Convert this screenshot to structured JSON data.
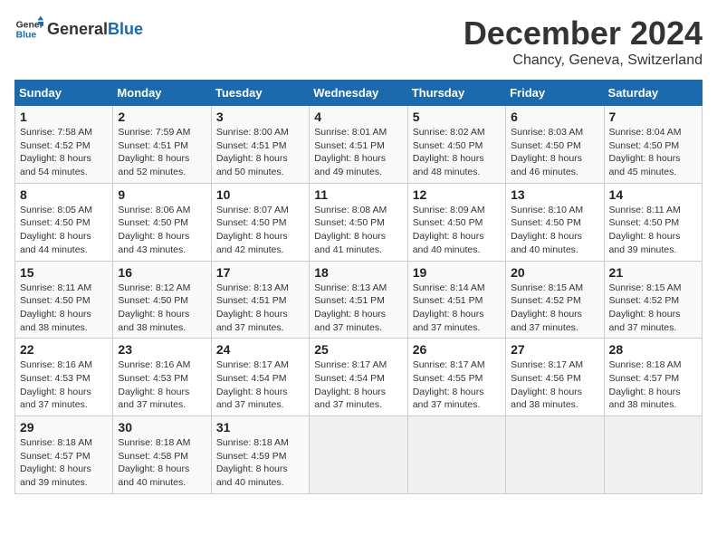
{
  "header": {
    "logo_general": "General",
    "logo_blue": "Blue",
    "month": "December 2024",
    "location": "Chancy, Geneva, Switzerland"
  },
  "weekdays": [
    "Sunday",
    "Monday",
    "Tuesday",
    "Wednesday",
    "Thursday",
    "Friday",
    "Saturday"
  ],
  "weeks": [
    [
      {
        "day": "1",
        "sunrise": "7:58 AM",
        "sunset": "4:52 PM",
        "daylight": "8 hours and 54 minutes."
      },
      {
        "day": "2",
        "sunrise": "7:59 AM",
        "sunset": "4:51 PM",
        "daylight": "8 hours and 52 minutes."
      },
      {
        "day": "3",
        "sunrise": "8:00 AM",
        "sunset": "4:51 PM",
        "daylight": "8 hours and 50 minutes."
      },
      {
        "day": "4",
        "sunrise": "8:01 AM",
        "sunset": "4:51 PM",
        "daylight": "8 hours and 49 minutes."
      },
      {
        "day": "5",
        "sunrise": "8:02 AM",
        "sunset": "4:50 PM",
        "daylight": "8 hours and 48 minutes."
      },
      {
        "day": "6",
        "sunrise": "8:03 AM",
        "sunset": "4:50 PM",
        "daylight": "8 hours and 46 minutes."
      },
      {
        "day": "7",
        "sunrise": "8:04 AM",
        "sunset": "4:50 PM",
        "daylight": "8 hours and 45 minutes."
      }
    ],
    [
      {
        "day": "8",
        "sunrise": "8:05 AM",
        "sunset": "4:50 PM",
        "daylight": "8 hours and 44 minutes."
      },
      {
        "day": "9",
        "sunrise": "8:06 AM",
        "sunset": "4:50 PM",
        "daylight": "8 hours and 43 minutes."
      },
      {
        "day": "10",
        "sunrise": "8:07 AM",
        "sunset": "4:50 PM",
        "daylight": "8 hours and 42 minutes."
      },
      {
        "day": "11",
        "sunrise": "8:08 AM",
        "sunset": "4:50 PM",
        "daylight": "8 hours and 41 minutes."
      },
      {
        "day": "12",
        "sunrise": "8:09 AM",
        "sunset": "4:50 PM",
        "daylight": "8 hours and 40 minutes."
      },
      {
        "day": "13",
        "sunrise": "8:10 AM",
        "sunset": "4:50 PM",
        "daylight": "8 hours and 40 minutes."
      },
      {
        "day": "14",
        "sunrise": "8:11 AM",
        "sunset": "4:50 PM",
        "daylight": "8 hours and 39 minutes."
      }
    ],
    [
      {
        "day": "15",
        "sunrise": "8:11 AM",
        "sunset": "4:50 PM",
        "daylight": "8 hours and 38 minutes."
      },
      {
        "day": "16",
        "sunrise": "8:12 AM",
        "sunset": "4:50 PM",
        "daylight": "8 hours and 38 minutes."
      },
      {
        "day": "17",
        "sunrise": "8:13 AM",
        "sunset": "4:51 PM",
        "daylight": "8 hours and 37 minutes."
      },
      {
        "day": "18",
        "sunrise": "8:13 AM",
        "sunset": "4:51 PM",
        "daylight": "8 hours and 37 minutes."
      },
      {
        "day": "19",
        "sunrise": "8:14 AM",
        "sunset": "4:51 PM",
        "daylight": "8 hours and 37 minutes."
      },
      {
        "day": "20",
        "sunrise": "8:15 AM",
        "sunset": "4:52 PM",
        "daylight": "8 hours and 37 minutes."
      },
      {
        "day": "21",
        "sunrise": "8:15 AM",
        "sunset": "4:52 PM",
        "daylight": "8 hours and 37 minutes."
      }
    ],
    [
      {
        "day": "22",
        "sunrise": "8:16 AM",
        "sunset": "4:53 PM",
        "daylight": "8 hours and 37 minutes."
      },
      {
        "day": "23",
        "sunrise": "8:16 AM",
        "sunset": "4:53 PM",
        "daylight": "8 hours and 37 minutes."
      },
      {
        "day": "24",
        "sunrise": "8:17 AM",
        "sunset": "4:54 PM",
        "daylight": "8 hours and 37 minutes."
      },
      {
        "day": "25",
        "sunrise": "8:17 AM",
        "sunset": "4:54 PM",
        "daylight": "8 hours and 37 minutes."
      },
      {
        "day": "26",
        "sunrise": "8:17 AM",
        "sunset": "4:55 PM",
        "daylight": "8 hours and 37 minutes."
      },
      {
        "day": "27",
        "sunrise": "8:17 AM",
        "sunset": "4:56 PM",
        "daylight": "8 hours and 38 minutes."
      },
      {
        "day": "28",
        "sunrise": "8:18 AM",
        "sunset": "4:57 PM",
        "daylight": "8 hours and 38 minutes."
      }
    ],
    [
      {
        "day": "29",
        "sunrise": "8:18 AM",
        "sunset": "4:57 PM",
        "daylight": "8 hours and 39 minutes."
      },
      {
        "day": "30",
        "sunrise": "8:18 AM",
        "sunset": "4:58 PM",
        "daylight": "8 hours and 40 minutes."
      },
      {
        "day": "31",
        "sunrise": "8:18 AM",
        "sunset": "4:59 PM",
        "daylight": "8 hours and 40 minutes."
      },
      null,
      null,
      null,
      null
    ]
  ],
  "labels": {
    "sunrise": "Sunrise:",
    "sunset": "Sunset:",
    "daylight": "Daylight:"
  }
}
